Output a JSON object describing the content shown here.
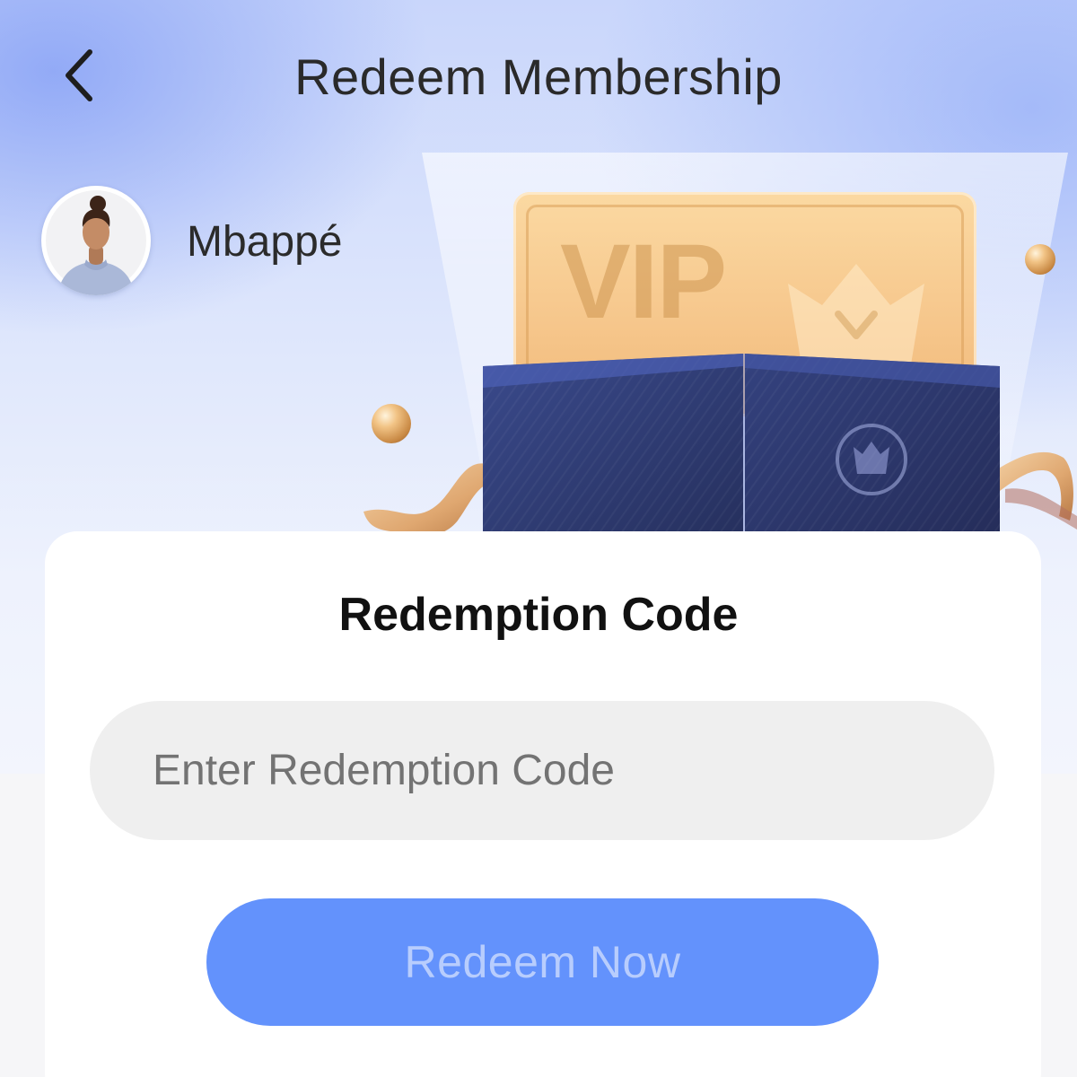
{
  "header": {
    "title": "Redeem Membership",
    "back_icon": "chevron-left-icon"
  },
  "user": {
    "name": "Mbappé",
    "avatar_icon": "avatar"
  },
  "hero": {
    "vip_card_text": "VIP",
    "crown_icon": "crown-icon"
  },
  "redeem": {
    "title": "Redemption Code",
    "input_placeholder": "Enter Redemption Code",
    "input_value": "",
    "button_label": "Redeem Now"
  },
  "colors": {
    "accent": "#6392fc",
    "button_text": "#b8cdfd",
    "vip_gold": "#f6c68b",
    "wallet_navy": "#2f3a73"
  }
}
